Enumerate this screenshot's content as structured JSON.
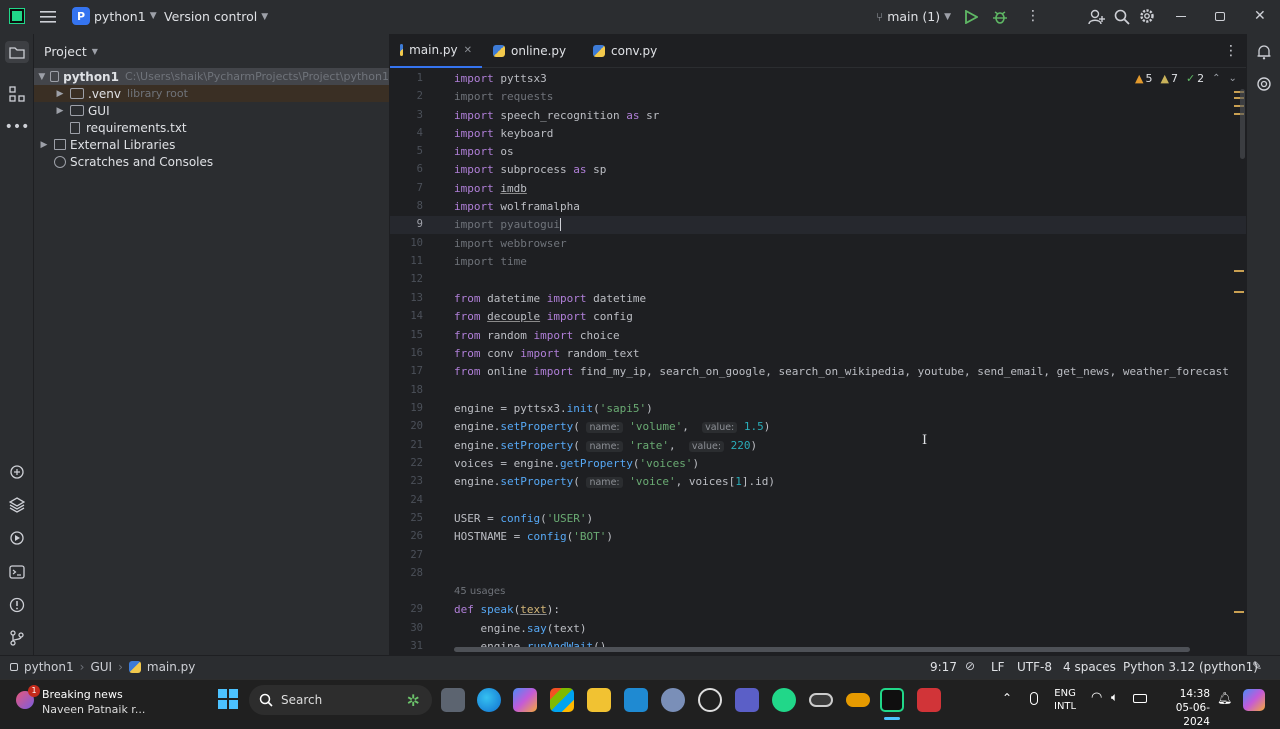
{
  "titlebar": {
    "project_badge": "P",
    "project_name": "python1",
    "vcs_label": "Version control",
    "branch": "main (1)"
  },
  "project_panel": {
    "header": "Project",
    "items": [
      {
        "label": "python1",
        "extra": "C:\\Users\\shaik\\PycharmProjects\\Project\\python1"
      },
      {
        "label": ".venv",
        "extra": "library root"
      },
      {
        "label": "GUI",
        "extra": ""
      },
      {
        "label": "requirements.txt",
        "extra": ""
      },
      {
        "label": "External Libraries",
        "extra": ""
      },
      {
        "label": "Scratches and Consoles",
        "extra": ""
      }
    ]
  },
  "tabs": [
    {
      "label": "main.py"
    },
    {
      "label": "online.py"
    },
    {
      "label": "conv.py"
    }
  ],
  "inspections": {
    "warnings": "5",
    "weak_warnings": "7",
    "ok": "2"
  },
  "editor": {
    "usages_hint": "45 usages",
    "line_numbers": [
      "1",
      "2",
      "3",
      "4",
      "5",
      "6",
      "7",
      "8",
      "9",
      "10",
      "11",
      "12",
      "13",
      "14",
      "15",
      "16",
      "17",
      "18",
      "19",
      "20",
      "21",
      "22",
      "23",
      "24",
      "25",
      "26",
      "27",
      "28",
      "29",
      "30",
      "31"
    ]
  },
  "statusbar": {
    "crumbs": [
      "python1",
      "GUI",
      "main.py"
    ],
    "position": "9:17",
    "line_sep": "LF",
    "encoding": "UTF-8",
    "indent": "4 spaces",
    "interpreter": "Python 3.12 (python1)"
  },
  "taskbar": {
    "news_title": "Breaking news",
    "news_sub": "Naveen Patnaik r...",
    "news_badge": "1",
    "search": "Search",
    "lang1": "ENG",
    "lang2": "INTL",
    "time": "14:38",
    "date": "05-06-2024"
  }
}
